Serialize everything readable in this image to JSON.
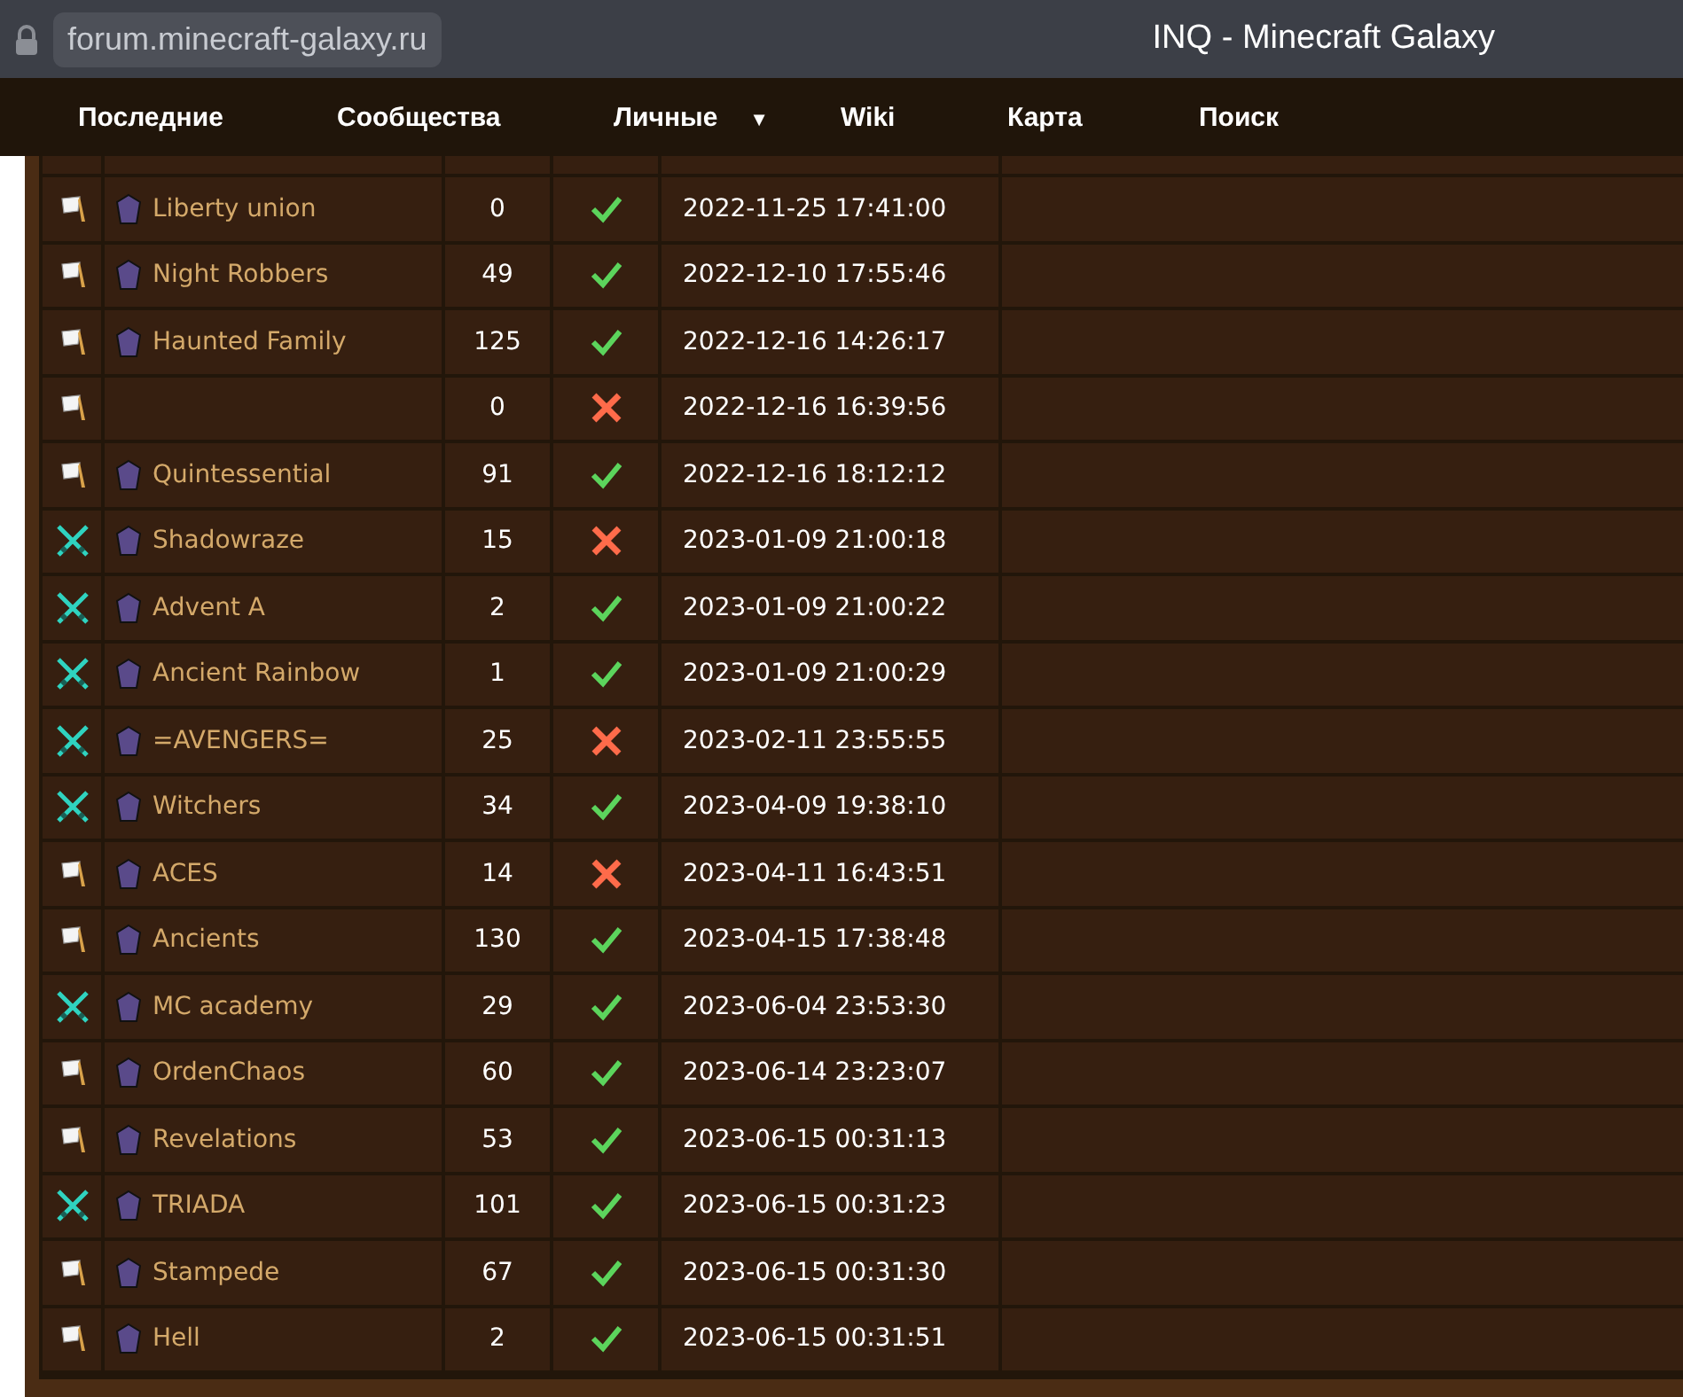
{
  "browser": {
    "url": "forum.minecraft-galaxy.ru",
    "title": "INQ - Minecraft Galaxy"
  },
  "nav": [
    {
      "label": "Последние"
    },
    {
      "label": "Сообщества"
    },
    {
      "label": "Личные",
      "caret": "▼"
    },
    {
      "label": "Wiki"
    },
    {
      "label": "Карта"
    },
    {
      "label": "Поиск"
    }
  ],
  "rows": [
    {
      "kind": "peace",
      "emblem": true,
      "name": "Liberty union",
      "count": "0",
      "ok": true,
      "date": "2022-11-25 17:41:00"
    },
    {
      "kind": "peace",
      "emblem": true,
      "name": "Night Robbers",
      "count": "49",
      "ok": true,
      "date": "2022-12-10 17:55:46"
    },
    {
      "kind": "peace",
      "emblem": true,
      "name": "Haunted Family",
      "count": "125",
      "ok": true,
      "date": "2022-12-16 14:26:17"
    },
    {
      "kind": "peace",
      "emblem": false,
      "count": "0",
      "ok": false,
      "date": "2022-12-16 16:39:56"
    },
    {
      "kind": "peace",
      "emblem": true,
      "name": "Quintessential",
      "count": "91",
      "ok": true,
      "date": "2022-12-16 18:12:12"
    },
    {
      "kind": "war",
      "emblem": true,
      "name": "Shadowraze",
      "count": "15",
      "ok": false,
      "date": "2023-01-09 21:00:18"
    },
    {
      "kind": "war",
      "emblem": true,
      "name": "Advent A",
      "count": "2",
      "ok": true,
      "date": "2023-01-09 21:00:22"
    },
    {
      "kind": "war",
      "emblem": true,
      "name": "Ancient Rainbow",
      "count": "1",
      "ok": true,
      "date": "2023-01-09 21:00:29"
    },
    {
      "kind": "war",
      "emblem": true,
      "name": "=AVENGERS=",
      "count": "25",
      "ok": false,
      "date": "2023-02-11 23:55:55"
    },
    {
      "kind": "war",
      "emblem": true,
      "name": "Witchers",
      "count": "34",
      "ok": true,
      "date": "2023-04-09 19:38:10"
    },
    {
      "kind": "peace",
      "emblem": true,
      "name": "ACES",
      "count": "14",
      "ok": false,
      "date": "2023-04-11 16:43:51"
    },
    {
      "kind": "peace",
      "emblem": true,
      "name": "Ancients",
      "count": "130",
      "ok": true,
      "date": "2023-04-15 17:38:48"
    },
    {
      "kind": "war",
      "emblem": true,
      "name": "MC academy",
      "count": "29",
      "ok": true,
      "date": "2023-06-04 23:53:30"
    },
    {
      "kind": "peace",
      "emblem": true,
      "name": "OrdenChaos",
      "count": "60",
      "ok": true,
      "date": "2023-06-14 23:23:07"
    },
    {
      "kind": "peace",
      "emblem": true,
      "name": "Revelations",
      "count": "53",
      "ok": true,
      "date": "2023-06-15 00:31:13"
    },
    {
      "kind": "war",
      "emblem": true,
      "name": "TRIADA",
      "count": "101",
      "ok": true,
      "date": "2023-06-15 00:31:23"
    },
    {
      "kind": "peace",
      "emblem": true,
      "name": "Stampede",
      "count": "67",
      "ok": true,
      "date": "2023-06-15 00:31:30"
    },
    {
      "kind": "peace",
      "emblem": true,
      "name": "Hell",
      "count": "2",
      "ok": true,
      "date": "2023-06-15 00:31:51"
    }
  ]
}
